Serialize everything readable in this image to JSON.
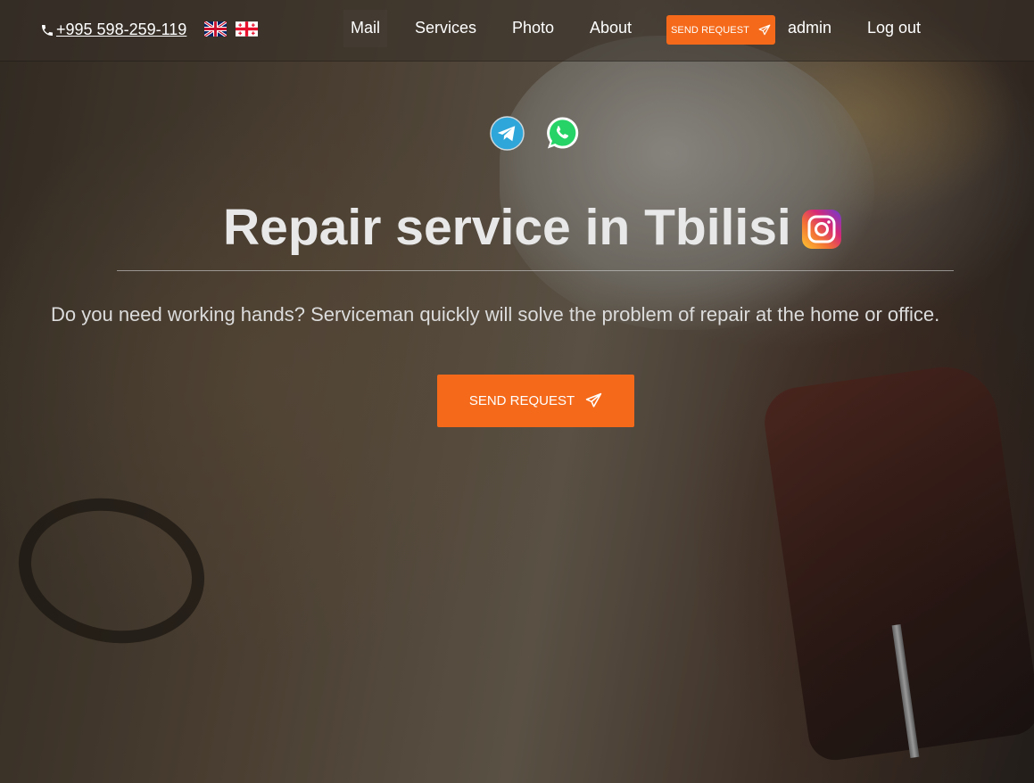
{
  "header": {
    "phone": "+995 598-259-119",
    "languages": [
      {
        "code": "en",
        "icon": "uk-flag-icon"
      },
      {
        "code": "ge",
        "icon": "georgia-flag-icon"
      }
    ],
    "nav": {
      "mail": "Mail",
      "services": "Services",
      "photo": "Photo",
      "about": "About",
      "send_request": "SEND REQUEST",
      "admin": "admin",
      "logout": "Log out"
    }
  },
  "social": {
    "telegram": "telegram-icon",
    "whatsapp": "whatsapp-icon",
    "instagram": "instagram-icon"
  },
  "hero": {
    "title": "Repair service in Tbilisi",
    "subtitle": "Do you need working hands? Serviceman quickly will solve the problem of repair at the home or office.",
    "cta": "SEND REQUEST"
  },
  "colors": {
    "accent": "#f46a1a",
    "text": "#ffffff"
  }
}
